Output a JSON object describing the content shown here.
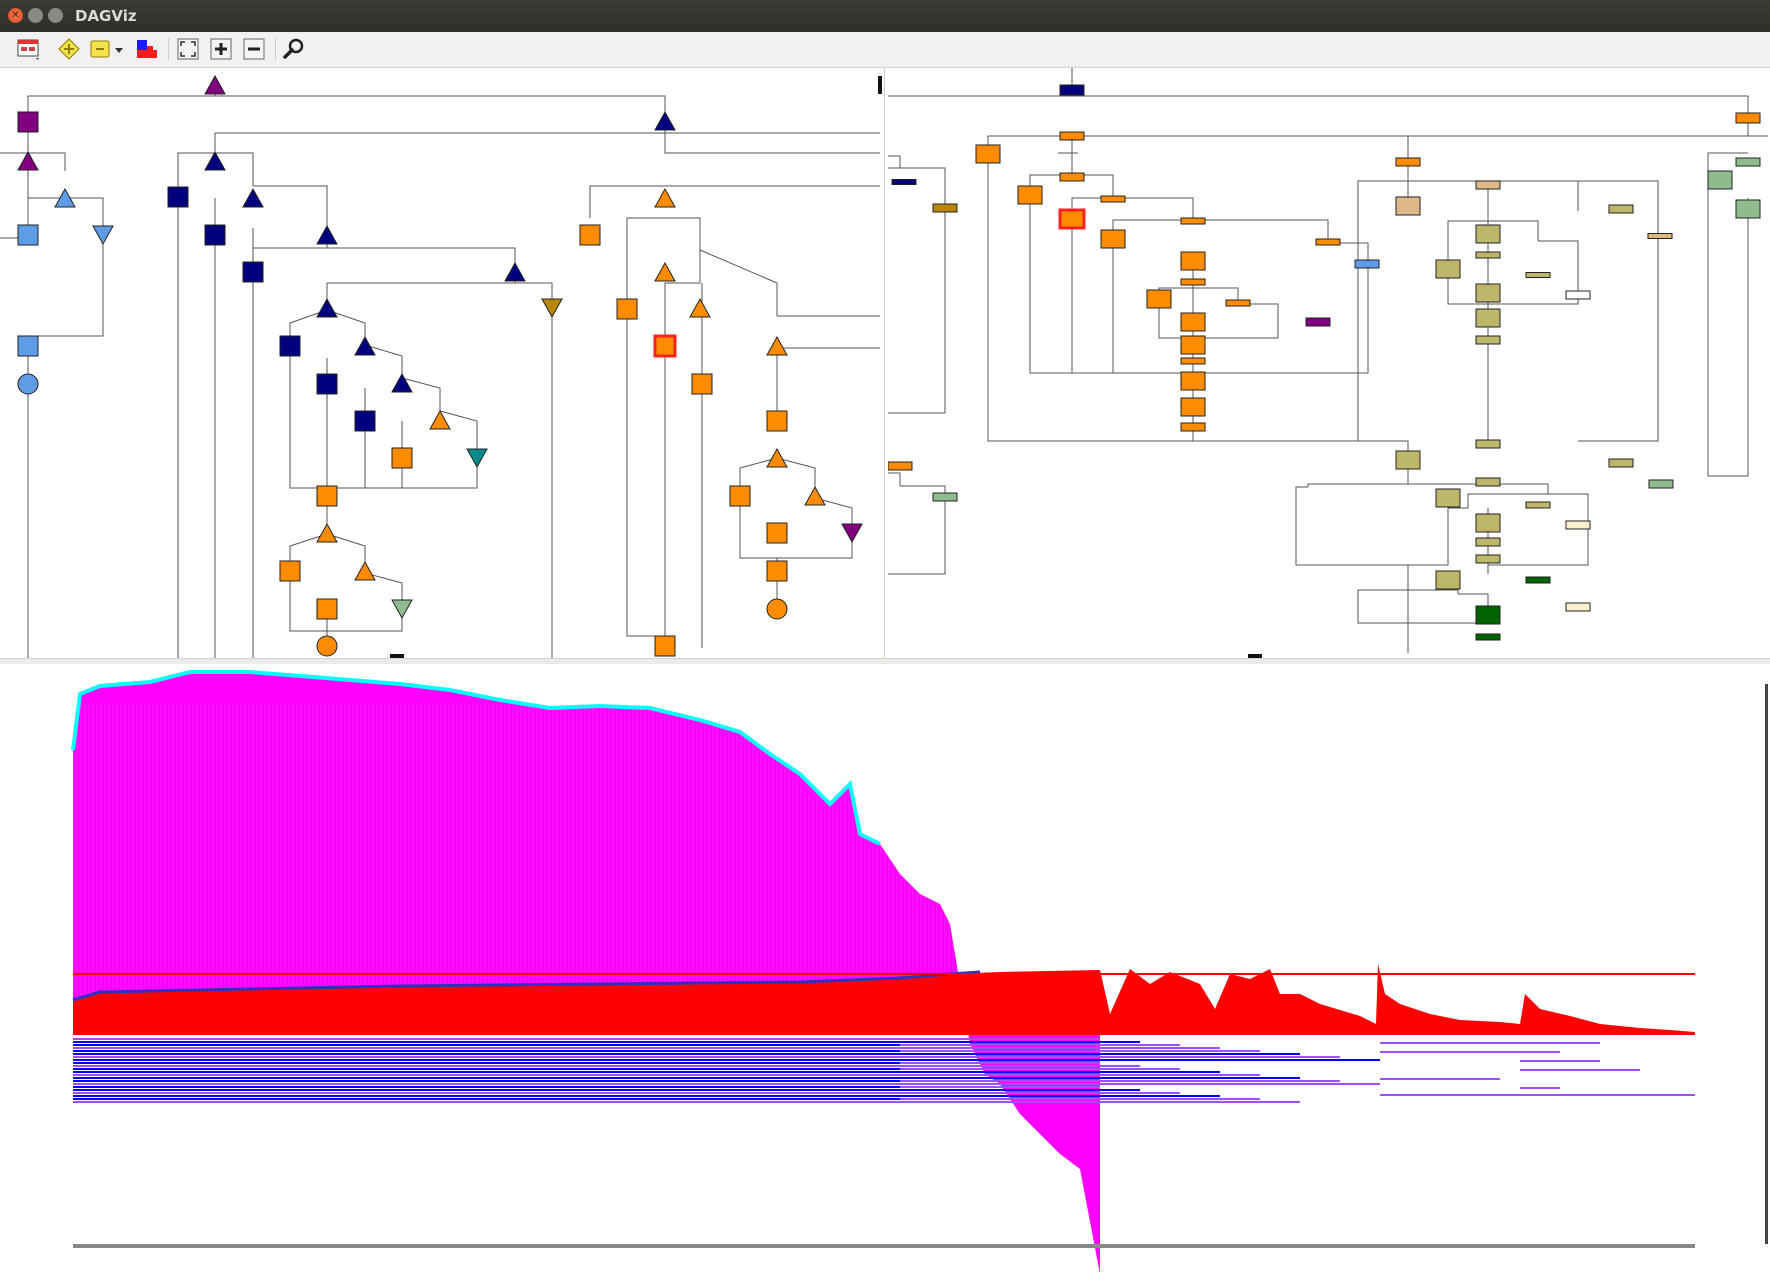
{
  "window": {
    "title": "DAGViz"
  },
  "toolbar": {
    "icons": [
      "layout-menu-icon",
      "expand-node-icon",
      "collapse-node-icon",
      "dropdown-arrow-icon",
      "stack-view-icon",
      "fit-to-view-icon",
      "zoom-in-icon",
      "zoom-out-icon",
      "search-icon"
    ]
  },
  "colors": {
    "orange": "#ff8c00",
    "navy": "#00007f",
    "purple": "#800080",
    "light_blue": "#5f9ce8",
    "khaki": "#bdb76b",
    "sea_green": "#8fbc8f",
    "dark_green": "#006400",
    "dark_goldenrod": "#b8860b",
    "teal": "#008b8b",
    "tan": "#deb887",
    "timeline_magenta": "#ff00ff",
    "timeline_cyan": "#00ffff",
    "timeline_red": "#ff0000",
    "timeline_blue": "#0000ff",
    "timeline_violet": "#9f4fff"
  }
}
